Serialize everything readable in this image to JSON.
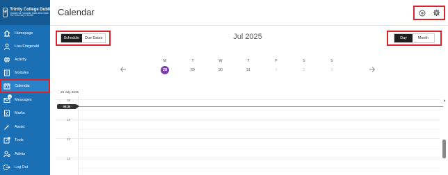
{
  "brand": {
    "name": "Trinity College Dublin",
    "line2": "Coláiste na Tríonóide, Baile Átha Cliath",
    "line3": "The University of Dublin"
  },
  "sidebar": {
    "items": [
      {
        "label": "Homepage",
        "icon": "home-icon"
      },
      {
        "label": "Lisa Fitzgerald",
        "icon": "user-icon"
      },
      {
        "label": "Activity",
        "icon": "globe-icon"
      },
      {
        "label": "Modules",
        "icon": "book-icon"
      },
      {
        "label": "Calendar",
        "icon": "calendar-icon",
        "active": true
      },
      {
        "label": "Messages",
        "icon": "messages-icon",
        "badge": "1"
      },
      {
        "label": "Marks",
        "icon": "marks-icon"
      },
      {
        "label": "Assist",
        "icon": "assist-icon"
      },
      {
        "label": "Tools",
        "icon": "tools-icon"
      },
      {
        "label": "Admin",
        "icon": "admin-icon"
      },
      {
        "label": "Log Out",
        "icon": "logout-icon"
      }
    ]
  },
  "header": {
    "title": "Calendar",
    "actions": [
      "add-event-icon",
      "settings-gear-icon"
    ]
  },
  "view_toggle": {
    "schedule": "Schedule",
    "due_dates": "Due Dates",
    "selected": "Schedule"
  },
  "range_toggle": {
    "day": "Day",
    "month": "Month",
    "selected": "Day"
  },
  "month_label": "Jul 2025",
  "week": [
    {
      "letter": "M",
      "num": "28",
      "today": true
    },
    {
      "letter": "T",
      "num": "29"
    },
    {
      "letter": "W",
      "num": "30"
    },
    {
      "letter": "T",
      "num": "31"
    },
    {
      "letter": "F",
      "num": "1",
      "muted": true
    },
    {
      "letter": "S",
      "num": "2",
      "muted": true
    },
    {
      "letter": "S",
      "num": "3",
      "muted": true
    }
  ],
  "date_label": "28 July 2025",
  "now_time": "09:30",
  "hours": [
    "09",
    "10",
    "11",
    "12"
  ],
  "colors": {
    "sidebar": "#1a6fb5",
    "highlight": "#d9232d",
    "today": "#7b3fa8"
  }
}
